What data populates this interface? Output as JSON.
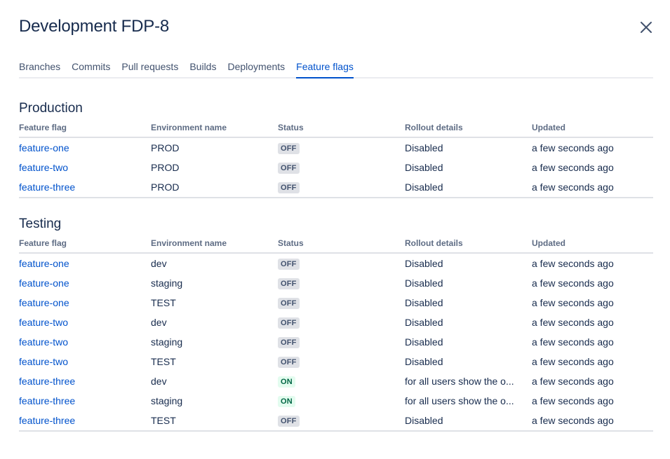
{
  "header": {
    "title": "Development FDP-8",
    "close_icon": "close-icon"
  },
  "tabs": [
    {
      "label": "Branches",
      "active": false
    },
    {
      "label": "Commits",
      "active": false
    },
    {
      "label": "Pull requests",
      "active": false
    },
    {
      "label": "Builds",
      "active": false
    },
    {
      "label": "Deployments",
      "active": false
    },
    {
      "label": "Feature flags",
      "active": true
    }
  ],
  "columns": [
    "Feature flag",
    "Environment name",
    "Status",
    "Rollout details",
    "Updated"
  ],
  "colors": {
    "link": "#0052CC",
    "on_bg": "#E3FCEF",
    "on_text": "#006644",
    "off_bg": "#DFE1E6",
    "off_text": "#42526E"
  },
  "sections": [
    {
      "title": "Production",
      "rows": [
        {
          "flag": "feature-one",
          "env": "PROD",
          "status": "OFF",
          "rollout": "Disabled",
          "updated": "a few seconds ago"
        },
        {
          "flag": "feature-two",
          "env": "PROD",
          "status": "OFF",
          "rollout": "Disabled",
          "updated": "a few seconds ago"
        },
        {
          "flag": "feature-three",
          "env": "PROD",
          "status": "OFF",
          "rollout": "Disabled",
          "updated": "a few seconds ago"
        }
      ]
    },
    {
      "title": "Testing",
      "rows": [
        {
          "flag": "feature-one",
          "env": "dev",
          "status": "OFF",
          "rollout": "Disabled",
          "updated": "a few seconds ago"
        },
        {
          "flag": "feature-one",
          "env": "staging",
          "status": "OFF",
          "rollout": "Disabled",
          "updated": "a few seconds ago"
        },
        {
          "flag": "feature-one",
          "env": "TEST",
          "status": "OFF",
          "rollout": "Disabled",
          "updated": "a few seconds ago"
        },
        {
          "flag": "feature-two",
          "env": "dev",
          "status": "OFF",
          "rollout": "Disabled",
          "updated": "a few seconds ago"
        },
        {
          "flag": "feature-two",
          "env": "staging",
          "status": "OFF",
          "rollout": "Disabled",
          "updated": "a few seconds ago"
        },
        {
          "flag": "feature-two",
          "env": "TEST",
          "status": "OFF",
          "rollout": "Disabled",
          "updated": "a few seconds ago"
        },
        {
          "flag": "feature-three",
          "env": "dev",
          "status": "ON",
          "rollout": "for all users show the o...",
          "updated": "a few seconds ago"
        },
        {
          "flag": "feature-three",
          "env": "staging",
          "status": "ON",
          "rollout": "for all users show the o...",
          "updated": "a few seconds ago"
        },
        {
          "flag": "feature-three",
          "env": "TEST",
          "status": "OFF",
          "rollout": "Disabled",
          "updated": "a few seconds ago"
        }
      ]
    }
  ]
}
